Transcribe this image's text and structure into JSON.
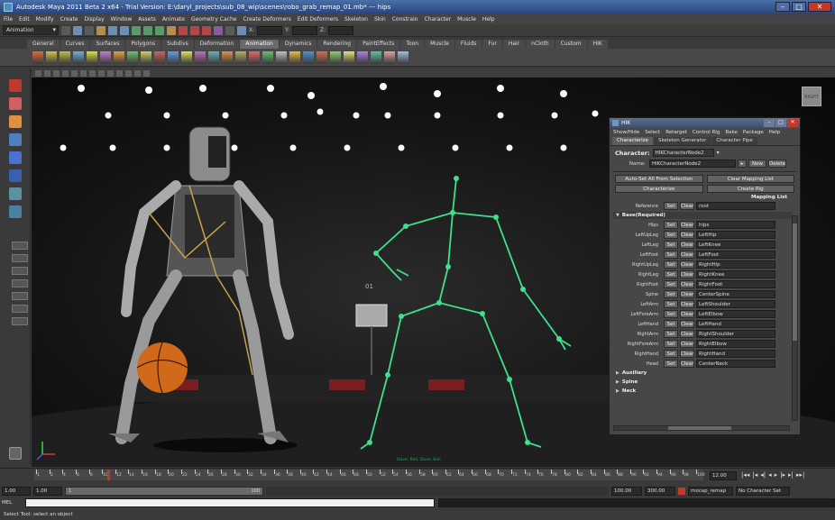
{
  "window": {
    "title": "Autodesk Maya 2011 Beta 2 x64 - Trial Version: E:\\daryl_projects\\sub_08_wip\\scenes\\robo_grab_remap_01.mb* --- hips"
  },
  "menubar": [
    "File",
    "Edit",
    "Modify",
    "Create",
    "Display",
    "Window",
    "Assets",
    "Animate",
    "Geometry Cache",
    "Create Deformers",
    "Edit Deformers",
    "Skeleton",
    "Skin",
    "Constrain",
    "Character",
    "Muscle",
    "Help"
  ],
  "status_line": {
    "mode": "Animation",
    "coord_labels": [
      "X:",
      "Y:",
      "Z:"
    ]
  },
  "shelf_tabs": [
    "General",
    "Curves",
    "Surfaces",
    "Polygons",
    "Subdivs",
    "Deformation",
    "Animation",
    "Dynamics",
    "Rendering",
    "PaintEffects",
    "Toon",
    "Muscle",
    "Fluids",
    "Fur",
    "Hair",
    "nCloth",
    "Custom",
    "HIK"
  ],
  "active_shelf_tab": "Animation",
  "viewport": {
    "view_cube_label": "RIGHT",
    "scoreboard": "01",
    "overlay_text": "Dave, Ball, Dave, Ball"
  },
  "hik": {
    "title": "HIK",
    "menu": [
      "Show/Hide",
      "Select",
      "Retarget",
      "Control Rig",
      "Bake",
      "Package",
      "Help"
    ],
    "tabs": [
      "Characterize",
      "Skeleton Generator",
      "Character Pipe"
    ],
    "character_label": "Character:",
    "character_value": "HIKCharacterNode2",
    "name_label": "Name:",
    "name_value": "HIKCharacterNode2",
    "new_btn": "New",
    "delete_btn": "Delete",
    "autoset_btn": "Auto-Set All From Selection",
    "clear_map_btn": "Clear Mapping List",
    "characterize_btn": "Characterize",
    "create_rig_btn": "Create Rig",
    "mapping_title": "Mapping List",
    "set_label": "Set",
    "clear_label": "Clear",
    "reference": {
      "label": "Reference",
      "value": "root"
    },
    "base_section": "Base(Required)",
    "slots": [
      {
        "label": "Hips",
        "value": "hips"
      },
      {
        "label": "LeftUpLeg",
        "value": "LeftHip"
      },
      {
        "label": "LeftLeg",
        "value": "LeftKnee"
      },
      {
        "label": "LeftFoot",
        "value": "LeftFoot"
      },
      {
        "label": "RightUpLeg",
        "value": "RightHip"
      },
      {
        "label": "RightLeg",
        "value": "RightKnee"
      },
      {
        "label": "RightFoot",
        "value": "RightFoot"
      },
      {
        "label": "Spine",
        "value": "CenterSpine"
      },
      {
        "label": "LeftArm",
        "value": "LeftShoulder"
      },
      {
        "label": "LeftForeArm",
        "value": "LeftElbow"
      },
      {
        "label": "LeftHand",
        "value": "LeftHand"
      },
      {
        "label": "RightArm",
        "value": "RightShoulder"
      },
      {
        "label": "RightForeArm",
        "value": "RightElbow"
      },
      {
        "label": "RightHand",
        "value": "RightHand"
      },
      {
        "label": "Head",
        "value": "CenterNeck"
      }
    ],
    "sections": [
      "Auxiliary",
      "Spine",
      "Neck"
    ]
  },
  "timeline": {
    "tick_labels": [
      "1",
      "2",
      "4",
      "6",
      "8",
      "10",
      "12",
      "14",
      "16",
      "18",
      "20",
      "22",
      "24",
      "26",
      "28",
      "30",
      "32",
      "34",
      "36",
      "38",
      "40",
      "42",
      "44",
      "46",
      "48",
      "50",
      "52",
      "54",
      "56",
      "58",
      "60",
      "62",
      "64",
      "66",
      "68",
      "70",
      "72",
      "74",
      "76",
      "78",
      "80",
      "82",
      "84",
      "86",
      "88",
      "90",
      "92",
      "94",
      "96",
      "98",
      "100"
    ],
    "current_time": "12.00",
    "playback_glyphs": [
      "|◂◂",
      "|◂",
      "◂|",
      "◂",
      "▸",
      "|▸",
      "▸|",
      "▸▸|"
    ]
  },
  "range_slider": {
    "start": "1.00",
    "inner_start": "1.00",
    "bar_start": "1",
    "bar_end": "100",
    "anim_end": "100.00",
    "range_end": "300.00",
    "anim_layer": "mocap_remap",
    "char_set": "No Character Set"
  },
  "command_line": {
    "lang": "MEL"
  },
  "help_line": "Select Tool: select an object",
  "colors": {
    "skeleton": "#3fe08a",
    "robot_accent": "#c9a24a",
    "titlebar": "#27437a",
    "ui_bg": "#3a3a3a"
  }
}
